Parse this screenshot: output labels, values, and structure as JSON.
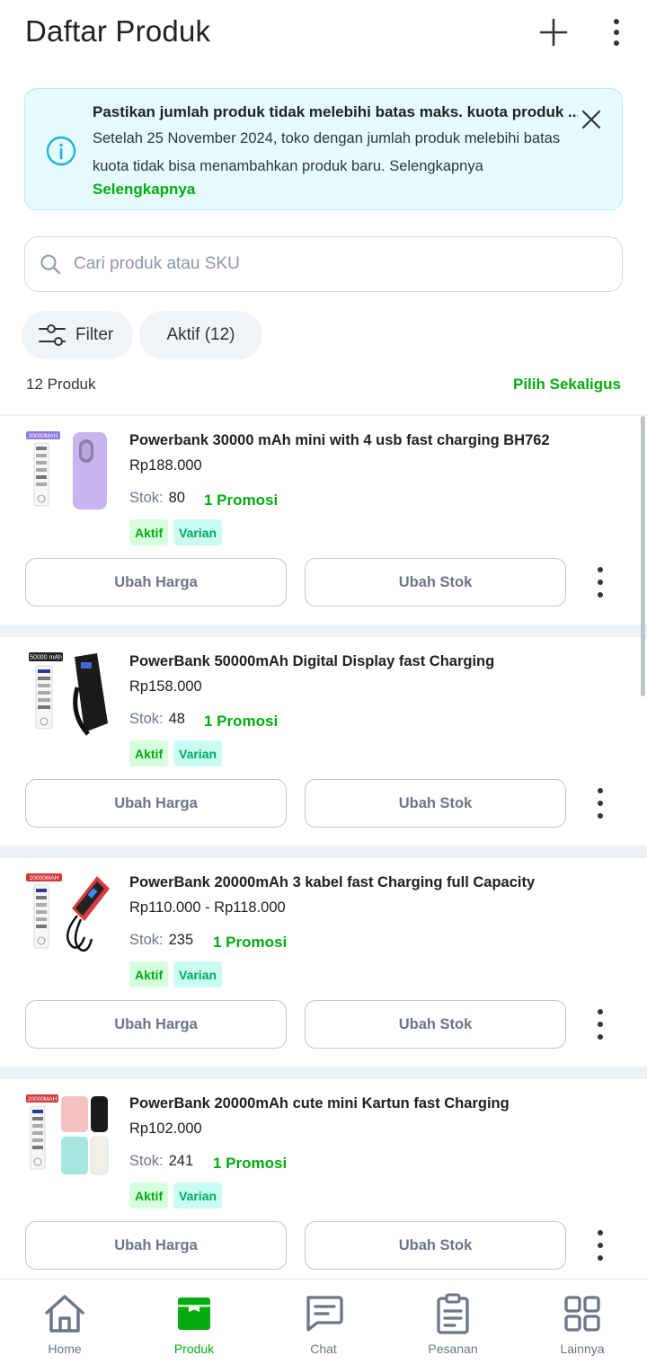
{
  "header": {
    "title": "Daftar Produk",
    "add_icon": "plus-icon",
    "more_icon": "vertical-dots-icon"
  },
  "banner": {
    "icon": "info-icon",
    "title": "Pastikan jumlah produk tidak melebihi batas maks. kuota produk ...",
    "text": "Setelah 25 November 2024, toko dengan jumlah produk melebihi batas kuota tidak bisa menambahkan produk baru. Selengkapnya",
    "link": "Selengkapnya",
    "close_icon": "close-icon"
  },
  "search": {
    "placeholder": "Cari produk atau SKU",
    "value": ""
  },
  "chips": {
    "filter_label": "Filter",
    "aktif_label": "Aktif (12)"
  },
  "summary": {
    "count": "12 Produk",
    "select_all": "Pilih Sekaligus"
  },
  "products": [
    {
      "name": "Powerbank 30000 mAh mini with 4 usb fast charging BH762",
      "price": "Rp188.000",
      "stock_label": "Stok:",
      "stock": "80",
      "promo": "1 Promosi",
      "badge_active": "Aktif",
      "badge_variant": "Varian",
      "btn_price": "Ubah Harga",
      "btn_stock": "Ubah Stok",
      "thumb_tag": "30000MAH",
      "thumb_color": "#c9b4ee"
    },
    {
      "name": "PowerBank 50000mAh Digital Display fast Charging",
      "price": "Rp158.000",
      "stock_label": "Stok:",
      "stock": "48",
      "promo": "1 Promosi",
      "badge_active": "Aktif",
      "badge_variant": "Varian",
      "btn_price": "Ubah Harga",
      "btn_stock": "Ubah Stok",
      "thumb_tag": "50000 mAh",
      "thumb_color": "#1a1a1a"
    },
    {
      "name": "PowerBank 20000mAh 3 kabel fast Charging full Capacity",
      "price": "Rp110.000 - Rp118.000",
      "stock_label": "Stok:",
      "stock": "235",
      "promo": "1 Promosi",
      "badge_active": "Aktif",
      "badge_variant": "Varian",
      "btn_price": "Ubah Harga",
      "btn_stock": "Ubah Stok",
      "thumb_tag": "20000MAH",
      "thumb_color": "#d73a3a"
    },
    {
      "name": "PowerBank 20000mAh cute mini Kartun fast Charging",
      "price": "Rp102.000",
      "stock_label": "Stok:",
      "stock": "241",
      "promo": "1 Promosi",
      "badge_active": "Aktif",
      "badge_variant": "Varian",
      "btn_price": "Ubah Harga",
      "btn_stock": "Ubah Stok",
      "thumb_tag": "20000MAH",
      "thumb_color": "#f4c2c2"
    }
  ],
  "nav": [
    {
      "label": "Home",
      "icon": "home-icon",
      "active": false
    },
    {
      "label": "Produk",
      "icon": "product-box-icon",
      "active": true
    },
    {
      "label": "Chat",
      "icon": "chat-icon",
      "active": false
    },
    {
      "label": "Pesanan",
      "icon": "order-clipboard-icon",
      "active": false
    },
    {
      "label": "Lainnya",
      "icon": "grid-icon",
      "active": false
    }
  ],
  "colors": {
    "brand_green": "#03ac0e",
    "banner_bg": "#e6fbfd",
    "info_icon": "#1eb3d4"
  }
}
